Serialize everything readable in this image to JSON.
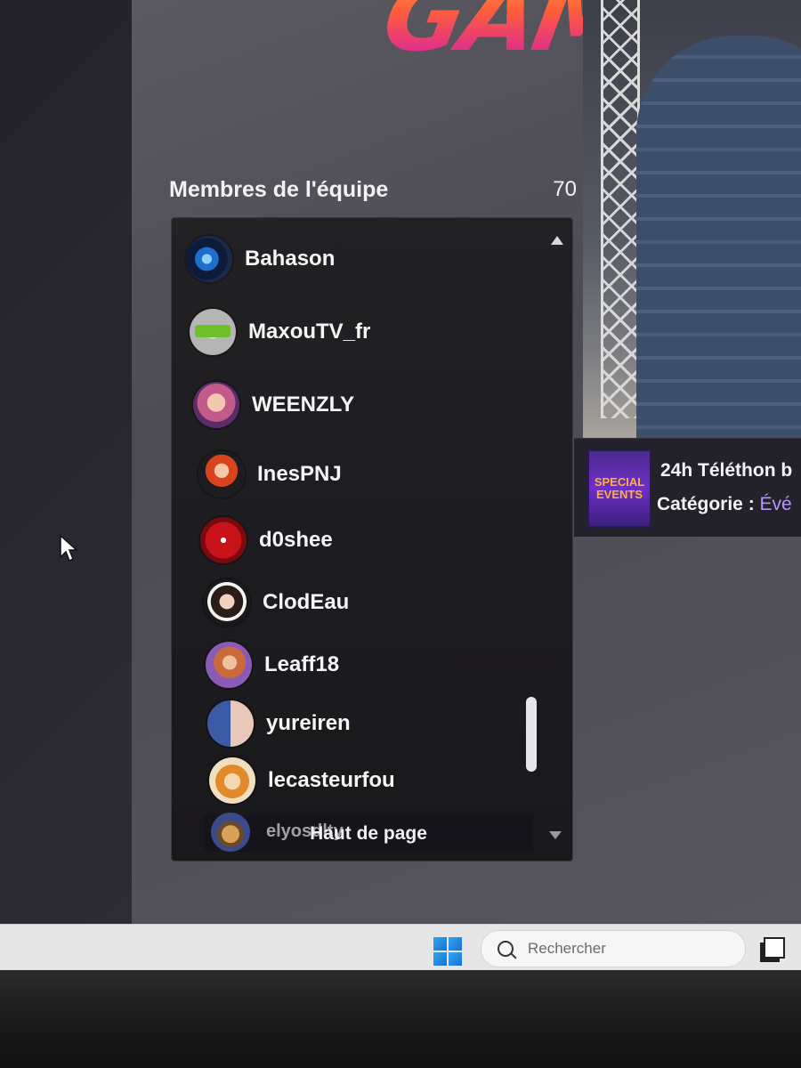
{
  "banner": {
    "text": "GAMIN"
  },
  "team": {
    "title": "Membres de l'équipe",
    "count": "70",
    "members": [
      {
        "name": "Bahason",
        "avatar": "blue-swirl"
      },
      {
        "name": "MaxouTV_fr",
        "avatar": "green-logo"
      },
      {
        "name": "WEENZLY",
        "avatar": "pink-portrait"
      },
      {
        "name": "InesPNJ",
        "avatar": "redhead-cartoon"
      },
      {
        "name": "d0shee",
        "avatar": "red-emblem"
      },
      {
        "name": "ClodEau",
        "avatar": "girl-portrait"
      },
      {
        "name": "Leaff18",
        "avatar": "redhead-portrait"
      },
      {
        "name": "yureiren",
        "avatar": "anime-characters"
      },
      {
        "name": "lecasteurfou",
        "avatar": "anime-boy"
      },
      {
        "name": "elyosdlty",
        "avatar": "cat-character"
      }
    ],
    "back_to_top": "Haut de page"
  },
  "stream": {
    "thumbnail_text": "SPECIAL EVENTS",
    "title": "24h Téléthon b",
    "category_label": "Catégorie :",
    "category_value": "Évé"
  },
  "taskbar": {
    "search_placeholder": "Rechercher"
  },
  "icons": {
    "start": "windows-start-icon",
    "search": "search-icon",
    "task_view": "task-view-icon",
    "scroll_up": "triangle-up-icon",
    "scroll_down": "triangle-down-icon",
    "cursor": "mouse-pointer-icon"
  },
  "colors": {
    "accent_purple": "#b794ff",
    "panel_bg": "#1d1c20",
    "page_bg": "#4f4d56"
  }
}
